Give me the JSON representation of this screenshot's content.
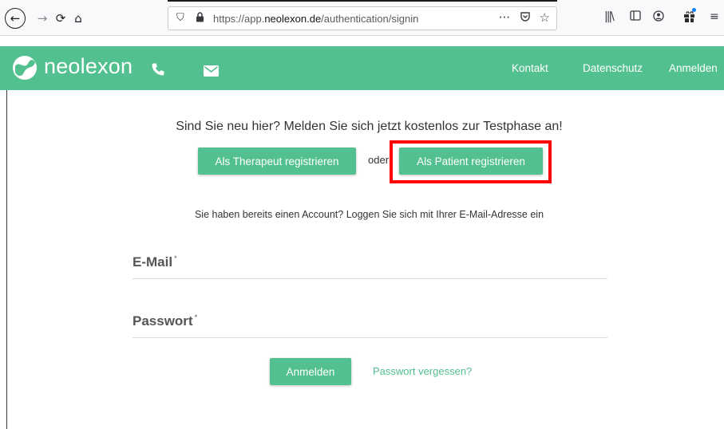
{
  "browser": {
    "url_prefix": "https://app.",
    "url_host": "neolexon.de",
    "url_path": "/authentication/signin",
    "back_icon": "←",
    "forward_icon": "→",
    "reload_icon": "⟳",
    "home_icon": "⌂",
    "more_icon": "···",
    "star_icon": "☆"
  },
  "header": {
    "logo_text": "neolexon",
    "nav": {
      "kontakt": "Kontakt",
      "datenschutz": "Datenschutz",
      "anmelden": "Anmelden"
    },
    "color": "#53c08f"
  },
  "register": {
    "headline": "Sind Sie neu hier? Melden Sie sich jetzt kostenlos zur Testphase an!",
    "therapist_button": "Als Therapeut registrieren",
    "or_text": "oder",
    "patient_button": "Als Patient registrieren",
    "highlight_color": "#ff0000"
  },
  "login": {
    "account_text": "Sie haben bereits einen Account? Loggen Sie sich mit Ihrer E-Mail-Adresse ein",
    "email_label": "E-Mail",
    "password_label": "Passwort",
    "required_mark": "*",
    "submit_button": "Anmelden",
    "forgot_link": "Passwort vergessen?"
  }
}
